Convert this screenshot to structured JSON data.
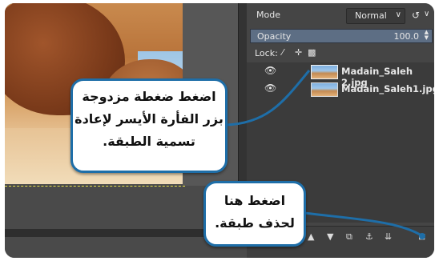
{
  "layers_panel": {
    "mode_label": "Mode",
    "mode_value": "Normal",
    "mode_arrow": "∨",
    "reset_icon": "↺",
    "opacity_label": "Opacity",
    "opacity_value": "100.0",
    "lock_label": "Lock:",
    "lock_icons": [
      "pencil-icon",
      "move-icon",
      "checker-icon"
    ],
    "layers": [
      {
        "name": "Madain_Saleh 2.jpg",
        "visible": true
      },
      {
        "name": "Madain_Saleh1.jpg",
        "visible": true
      }
    ]
  },
  "callouts": {
    "rename": [
      "اضغط ضغطة مزدوجة",
      "بزر الفأرة الأيسر لإعادة",
      "تسمية الطبقة."
    ],
    "delete": [
      "اضغط هنا",
      "لحذف طبقة."
    ]
  },
  "colors": {
    "callout_border": "#1e6ea8",
    "panel_bg": "#454545",
    "opacity_bar": "#5d6e84"
  }
}
